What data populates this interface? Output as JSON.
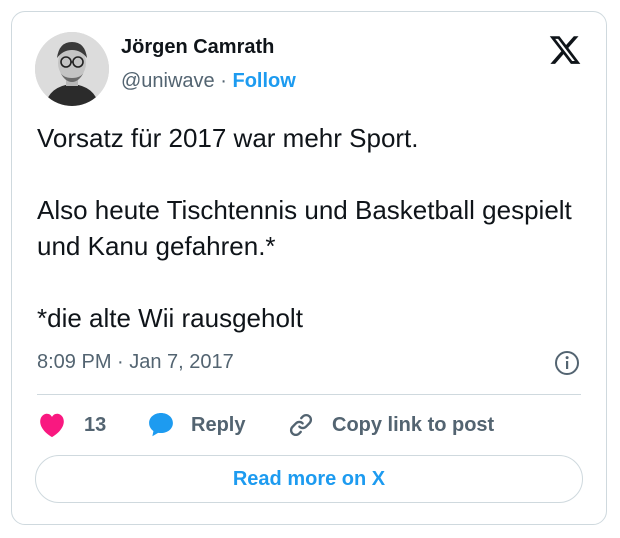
{
  "author": {
    "name": "Jörgen Camrath",
    "handle": "@uniwave",
    "separator": "·",
    "follow_label": "Follow"
  },
  "post": {
    "text": "Vorsatz für 2017 war mehr Sport.\n\nAlso heute Tischtennis und Basketball gespielt und Kanu gefahren.*\n\n*die alte Wii rausgeholt",
    "timestamp": "8:09 PM · Jan 7, 2017"
  },
  "actions": {
    "like_count": "13",
    "reply_label": "Reply",
    "copy_link_label": "Copy link to post"
  },
  "footer": {
    "read_more_label": "Read more on X"
  },
  "icons": {
    "brand": "x-logo-icon",
    "info": "info-icon",
    "like": "heart-icon",
    "reply": "speech-bubble-icon",
    "copy": "link-icon"
  },
  "colors": {
    "accent": "#1d9bf0",
    "like": "#f91880",
    "text": "#0f1419",
    "muted": "#536471",
    "border": "#cfd9de"
  }
}
